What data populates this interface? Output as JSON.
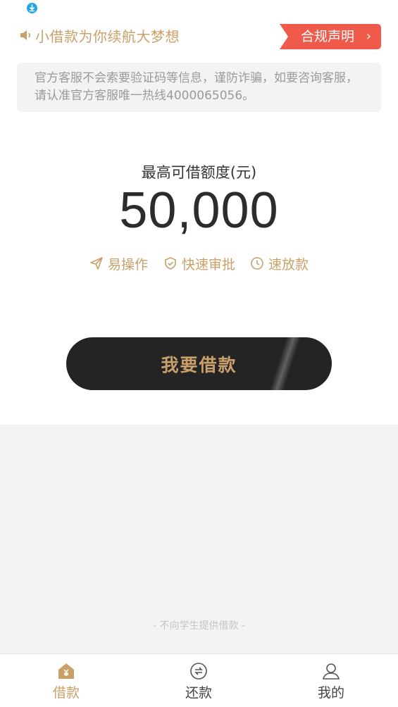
{
  "announcement": {
    "icon": "speaker-icon",
    "text": "小借款为你续航大梦想",
    "compliance_label": "合规声明",
    "compliance_arrow": "›"
  },
  "notice": {
    "text": "官方客服不会索要验证码等信息，谨防诈骗，如要咨询客服，请认准官方客服唯一热线4000065056。"
  },
  "limit": {
    "title": "最高可借额度(元)",
    "amount": "50,000"
  },
  "features": [
    {
      "icon": "paper-plane-icon",
      "label": "易操作"
    },
    {
      "icon": "shield-check-icon",
      "label": "快速审批"
    },
    {
      "icon": "clock-icon",
      "label": "速放款"
    }
  ],
  "borrow_button": {
    "label": "我要借款"
  },
  "student_note": "- 不向学生提供借款 -",
  "tabbar": [
    {
      "icon": "home-yuan-icon",
      "label": "借款",
      "active": true
    },
    {
      "icon": "exchange-icon",
      "label": "还款",
      "active": false
    },
    {
      "icon": "user-icon",
      "label": "我的",
      "active": false
    }
  ],
  "colors": {
    "gold": "#c9a06a",
    "compliance_red": "#f05a4a",
    "dark_button": "#242424",
    "notice_bg": "#f3f3f3",
    "status_blue": "#1fa7e6"
  }
}
